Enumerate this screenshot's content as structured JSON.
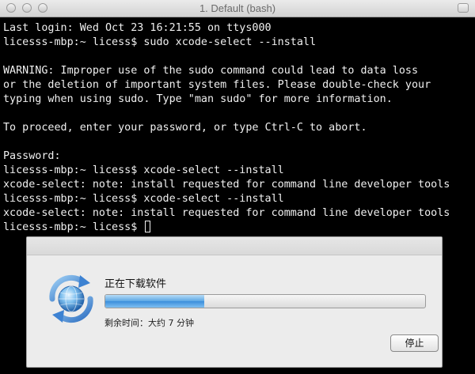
{
  "window": {
    "title": "1. Default (bash)"
  },
  "terminal": {
    "lines": [
      "Last login: Wed Oct 23 16:21:55 on ttys000",
      "licesss-mbp:~ licess$ sudo xcode-select --install",
      "",
      "WARNING: Improper use of the sudo command could lead to data loss",
      "or the deletion of important system files. Please double-check your",
      "typing when using sudo. Type \"man sudo\" for more information.",
      "",
      "To proceed, enter your password, or type Ctrl-C to abort.",
      "",
      "Password:",
      "licesss-mbp:~ licess$ xcode-select --install",
      "xcode-select: note: install requested for command line developer tools",
      "licesss-mbp:~ licess$ xcode-select --install",
      "xcode-select: note: install requested for command line developer tools"
    ],
    "prompt": "licesss-mbp:~ licess$ "
  },
  "dialog": {
    "title": "正在下载软件",
    "progress_percent": 31,
    "remaining": "剩余时间：大约 7 分钟",
    "stop_label": "停止",
    "icon": "software-update-icon",
    "accent": "#3b8edb"
  }
}
